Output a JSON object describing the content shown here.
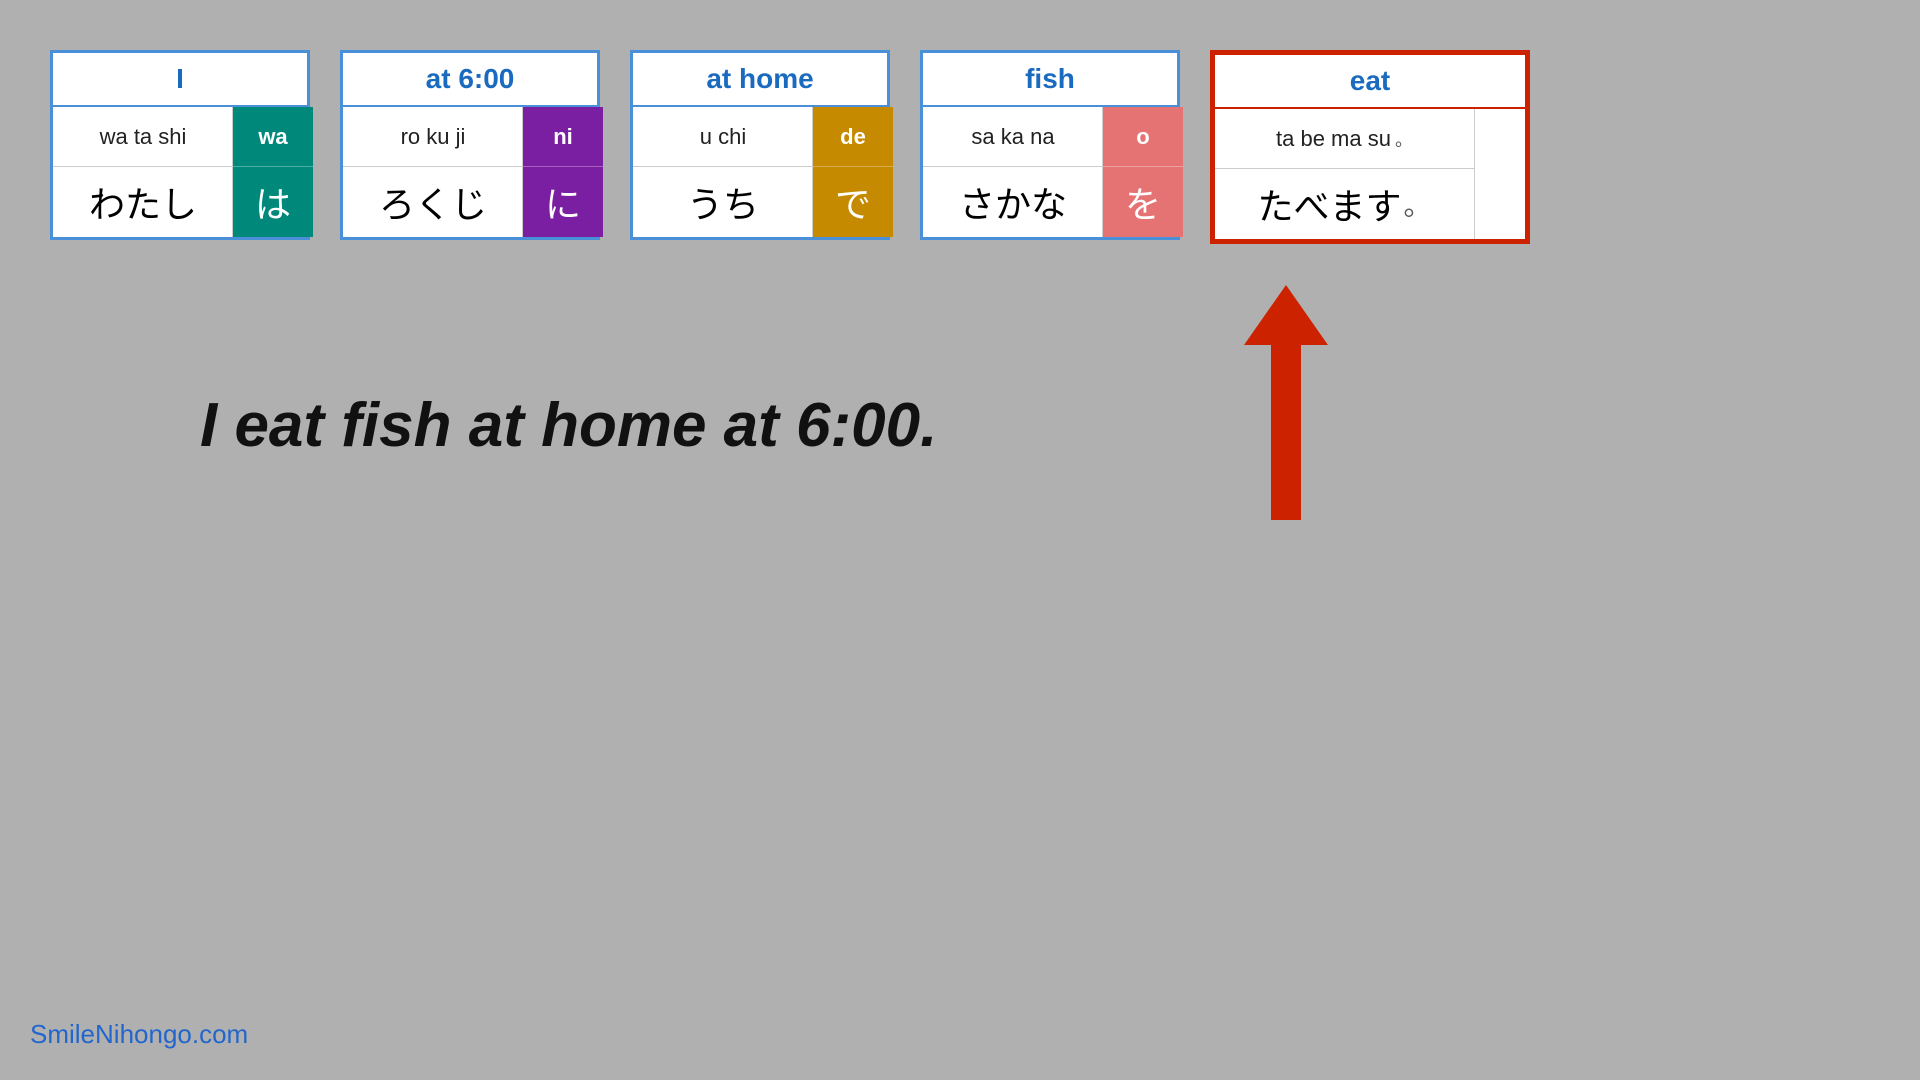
{
  "cards": [
    {
      "id": "card-I",
      "header": "I",
      "main_romaji": "wa ta shi",
      "main_kana": "わたし",
      "particle_romaji": "wa",
      "particle_kana": "は",
      "particle_color": "#00897b",
      "highlighted": false
    },
    {
      "id": "card-600",
      "header": "at 6:00",
      "main_romaji": "ro  ku ji",
      "main_kana": "ろくじ",
      "particle_romaji": "ni",
      "particle_kana": "に",
      "particle_color": "#7b1fa2",
      "highlighted": false
    },
    {
      "id": "card-home",
      "header": "at home",
      "main_romaji": "u  chi",
      "main_kana": "うち",
      "particle_romaji": "de",
      "particle_kana": "で",
      "particle_color": "#c68a00",
      "highlighted": false
    },
    {
      "id": "card-fish",
      "header": "fish",
      "main_romaji": "sa ka na",
      "main_kana": "さかな",
      "particle_romaji": "o",
      "particle_kana": "を",
      "particle_color": "#e57373",
      "highlighted": false
    },
    {
      "id": "card-eat",
      "header": "eat",
      "main_romaji": "ta be ma su",
      "main_kana": "たべます",
      "period": "。",
      "highlighted": true
    }
  ],
  "sentence": "I eat fish at home at 6:00.",
  "watermark": "SmileNihongo.com",
  "arrow": {
    "visible": true,
    "color": "#cc2200"
  }
}
